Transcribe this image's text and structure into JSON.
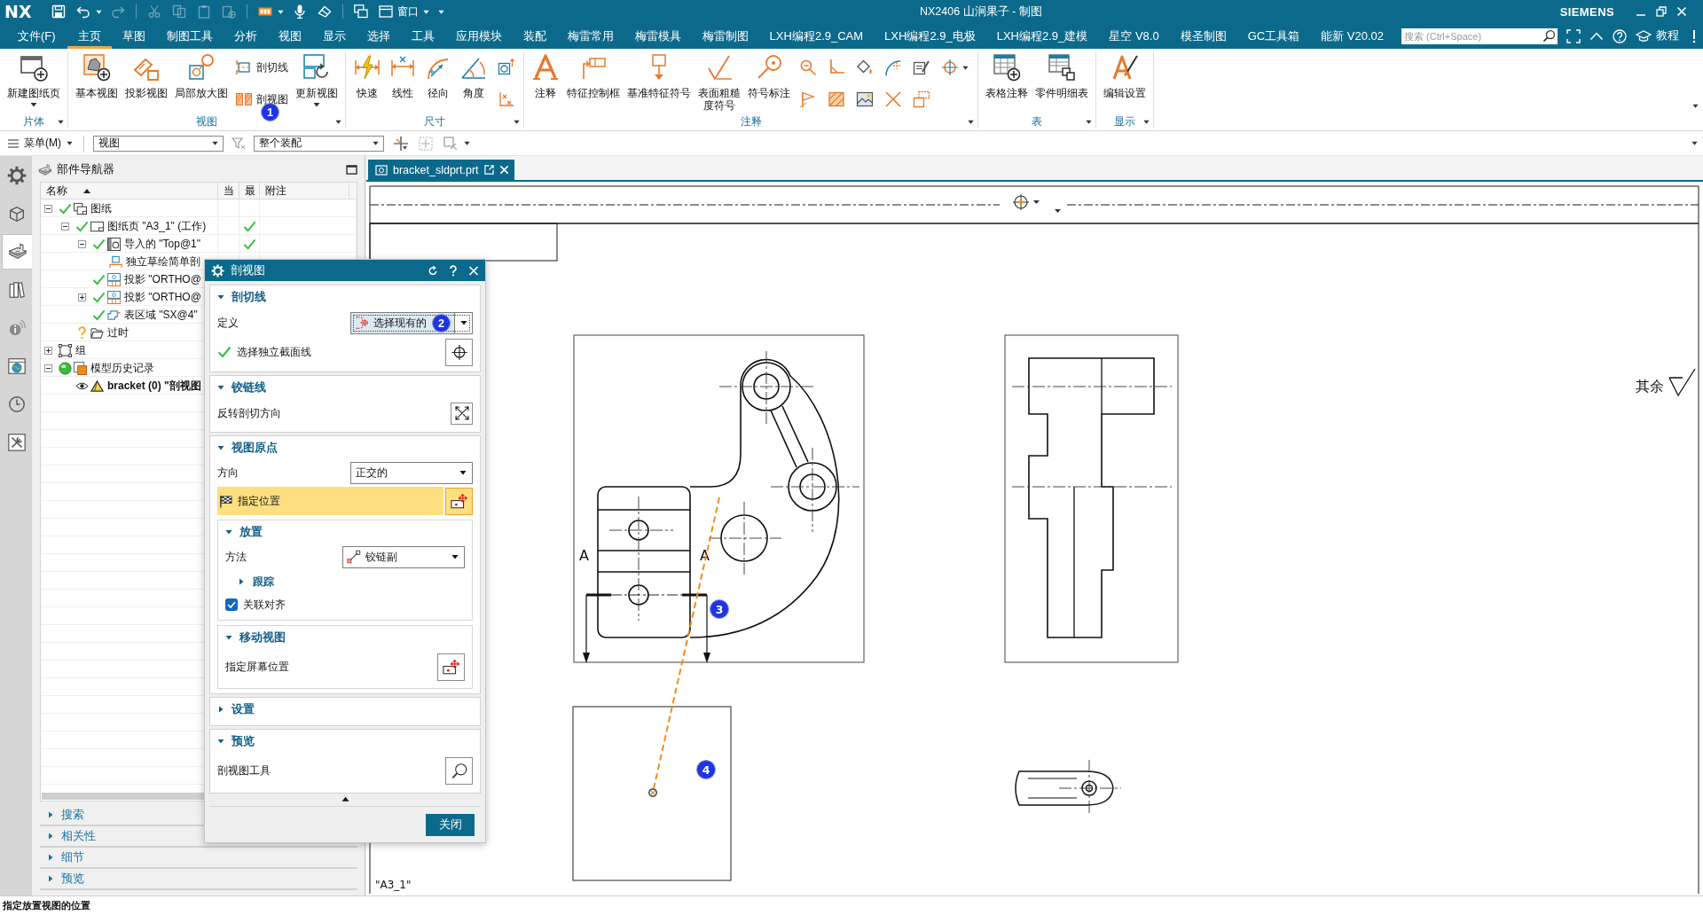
{
  "title_bar": {
    "logo": "NX",
    "quick_access": [
      {
        "disabled": false
      },
      {
        "disabled": false,
        "dropdown": true
      },
      {
        "disabled": true
      },
      {
        "disabled": true
      },
      {
        "disabled": true
      },
      {
        "disabled": true
      },
      {
        "disabled": true
      },
      {
        "disabled": false,
        "dropdown": true
      },
      {
        "disabled": false
      },
      {
        "disabled": false
      },
      {
        "disabled": false
      }
    ],
    "window_menu": "窗口",
    "title": "NX2406 山涧果子 - 制图",
    "brand": "SIEMENS"
  },
  "menu_bar": {
    "file": "文件(F)",
    "tabs": [
      {
        "label": "主页",
        "selected": true
      },
      {
        "label": "草图",
        "selected": false
      },
      {
        "label": "制图工具",
        "selected": false
      },
      {
        "label": "分析",
        "selected": false
      },
      {
        "label": "视图",
        "selected": false
      },
      {
        "label": "显示",
        "selected": false
      },
      {
        "label": "选择",
        "selected": false
      },
      {
        "label": "工具",
        "selected": false
      },
      {
        "label": "应用模块",
        "selected": false
      },
      {
        "label": "装配",
        "selected": false
      },
      {
        "label": "梅雷常用",
        "selected": false
      },
      {
        "label": "梅雷模具",
        "selected": false
      },
      {
        "label": "梅雷制图",
        "selected": false
      },
      {
        "label": "LXH编程2.9_CAM",
        "selected": false
      },
      {
        "label": "LXH编程2.9_电极",
        "selected": false
      },
      {
        "label": "LXH编程2.9_建模",
        "selected": false
      },
      {
        "label": "星空 V8.0",
        "selected": false
      },
      {
        "label": "模圣制图",
        "selected": false
      },
      {
        "label": "GC工具箱",
        "selected": false
      },
      {
        "label": "能新 V20.02",
        "selected": false
      }
    ],
    "search": {
      "placeholder": "搜索 (Ctrl+Space)"
    },
    "help_label": "教程"
  },
  "ribbon": {
    "groups": [
      {
        "label": "片体",
        "items": [
          {
            "kind": "large",
            "label": "新建图纸页",
            "dropdown": true
          }
        ]
      },
      {
        "label": "视图",
        "items": [
          {
            "kind": "large",
            "label": "基本视图"
          },
          {
            "kind": "large",
            "label": "投影视图"
          },
          {
            "kind": "large",
            "label": "局部放大图"
          },
          {
            "kind": "small",
            "label": "剖切线"
          },
          {
            "kind": "small",
            "label": "剖视图",
            "callout": "1"
          },
          {
            "kind": "large",
            "label": "更新视图",
            "dropdown": true
          }
        ]
      },
      {
        "label": "尺寸",
        "items": [
          {
            "kind": "large",
            "label": "快速"
          },
          {
            "kind": "large",
            "label": "线性"
          },
          {
            "kind": "large",
            "label": "径向"
          },
          {
            "kind": "large",
            "label": "角度"
          },
          {
            "kind": "icon"
          },
          {
            "kind": "icon"
          }
        ]
      },
      {
        "label": "注释",
        "items": [
          {
            "kind": "large",
            "label": "注释"
          },
          {
            "kind": "large",
            "label": "特征控制框"
          },
          {
            "kind": "large",
            "label": "基准特征符号"
          },
          {
            "kind": "large",
            "label": "表面粗糙度符号"
          },
          {
            "kind": "large",
            "label": "符号标注"
          },
          {
            "kind": "icon"
          },
          {
            "kind": "icon"
          },
          {
            "kind": "icon"
          },
          {
            "kind": "icon"
          },
          {
            "kind": "icon"
          },
          {
            "kind": "icon"
          },
          {
            "kind": "icon"
          },
          {
            "kind": "icon"
          },
          {
            "kind": "icon"
          },
          {
            "kind": "icon"
          },
          {
            "kind": "icon",
            "dropdown": true
          }
        ]
      },
      {
        "label": "表",
        "items": [
          {
            "kind": "large",
            "label": "表格注释"
          },
          {
            "kind": "large",
            "label": "零件明细表"
          }
        ]
      },
      {
        "label": "显示",
        "items": [
          {
            "kind": "large",
            "label": "编辑设置"
          }
        ]
      }
    ]
  },
  "selection_bar": {
    "menu": "菜单(M)",
    "type_filter": "视图",
    "scope": "整个装配"
  },
  "resource_bar": {
    "tabs": [
      {
        "selected": false
      },
      {
        "selected": false
      },
      {
        "selected": true
      },
      {
        "selected": false
      },
      {
        "selected": false
      },
      {
        "selected": false
      },
      {
        "selected": false
      },
      {
        "selected": false
      }
    ]
  },
  "part_navigator": {
    "title": "部件导航器",
    "columns": [
      {
        "label": "名称",
        "sorted": true
      },
      {
        "label": "当"
      },
      {
        "label": "最"
      },
      {
        "label": "附注"
      }
    ],
    "tree": [
      {
        "label": "图纸",
        "kind": "drawing",
        "checked": true,
        "expanded": true,
        "children": [
          {
            "label": "图纸页 \"A3_1\" (工作)",
            "kind": "sheet",
            "checked": true,
            "latest": true,
            "expanded": true,
            "children": [
              {
                "label": "导入的 \"Top@1\"",
                "kind": "imported-view",
                "checked": true,
                "latest": true,
                "expanded": true,
                "children": [
                  {
                    "label": "独立草绘简单剖",
                    "kind": "sketch"
                  }
                ]
              },
              {
                "label": "投影 \"ORTHO@",
                "kind": "projected-view",
                "checked": true
              },
              {
                "label": "投影 \"ORTHO@",
                "kind": "projected-view",
                "checked": true,
                "expanded": false
              },
              {
                "label": "表区域 \"SX@4\"",
                "kind": "region",
                "checked": true
              }
            ]
          },
          {
            "label": "过时",
            "kind": "folder",
            "outdated": true
          }
        ]
      },
      {
        "label": "组",
        "kind": "group",
        "expanded": false
      },
      {
        "label": "模型历史记录",
        "kind": "history",
        "active": true,
        "expanded": true,
        "children": [
          {
            "label": "bracket (0) \"剖视图",
            "kind": "body",
            "visible": true
          }
        ]
      }
    ],
    "sections": [
      {
        "label": "搜索",
        "expanded": false
      },
      {
        "label": "相关性",
        "expanded": false
      },
      {
        "label": "细节",
        "expanded": false
      },
      {
        "label": "预览",
        "expanded": false
      }
    ]
  },
  "dialog": {
    "title": "剖视图",
    "sections": [
      {
        "title": "剖切线",
        "expanded": true,
        "rows": [
          {
            "kind": "definition",
            "label": "定义",
            "value": "选择现有的",
            "callout": "2"
          },
          {
            "kind": "selection",
            "label": "选择独立截面线",
            "done": true
          }
        ]
      },
      {
        "title": "铰链线",
        "expanded": true,
        "rows": [
          {
            "kind": "reverse",
            "label": "反转剖切方向"
          }
        ]
      },
      {
        "title": "视图原点",
        "expanded": true,
        "rows": [
          {
            "kind": "dropdown",
            "label": "方向",
            "value": "正交的"
          },
          {
            "kind": "location",
            "label": "指定位置",
            "selected": true
          },
          {
            "kind": "group",
            "title": "放置",
            "expanded": true,
            "rows": [
              {
                "kind": "method",
                "label": "方法",
                "value": "铰链副"
              },
              {
                "kind": "subsection",
                "title": "跟踪",
                "expanded": false
              },
              {
                "kind": "checkbox",
                "label": "关联对齐",
                "checked": true
              }
            ]
          },
          {
            "kind": "group",
            "title": "移动视图",
            "expanded": true,
            "rows": [
              {
                "kind": "position",
                "label": "指定屏幕位置"
              }
            ]
          }
        ]
      },
      {
        "title": "设置",
        "expanded": false
      },
      {
        "title": "预览",
        "expanded": true,
        "rows": [
          {
            "kind": "tool",
            "label": "剖视图工具"
          }
        ]
      }
    ],
    "close_button": "关闭"
  },
  "graphics": {
    "tab": {
      "label": "bracket_sldprt.prt"
    },
    "drawing": {
      "section_labels": [
        "A",
        "A"
      ],
      "roughness_note": "其余",
      "callouts": [
        "3",
        "4"
      ],
      "sheet_name": "\"A3_1\""
    }
  },
  "status_bar": {
    "message": "指定放置视图的位置"
  }
}
